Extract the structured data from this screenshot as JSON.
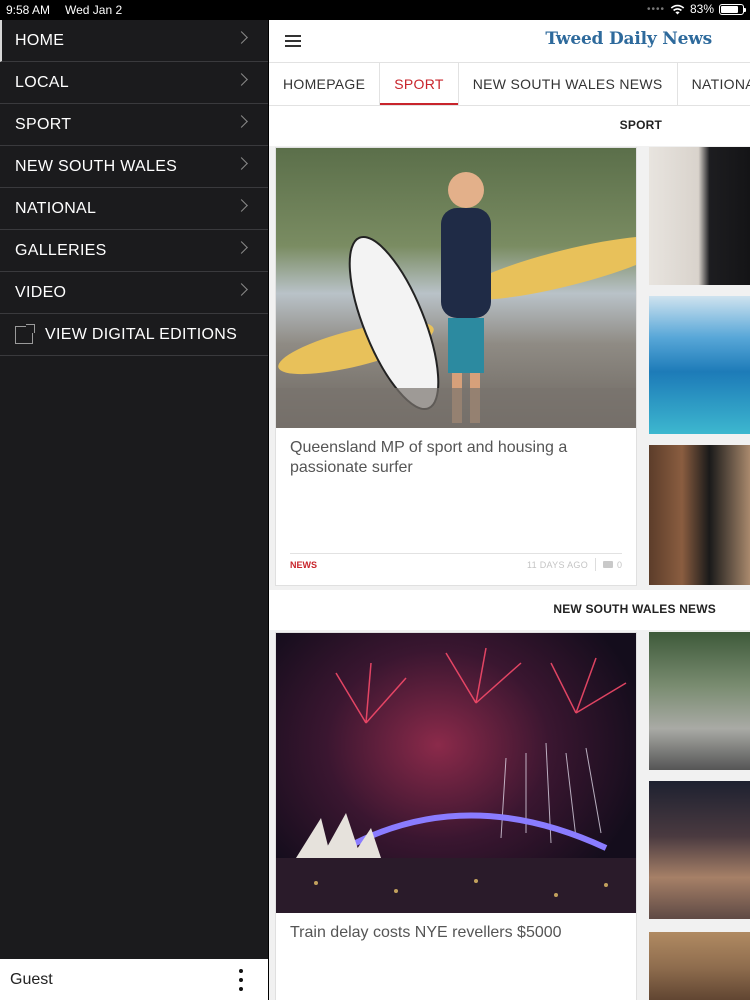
{
  "status_bar": {
    "time": "9:58 AM",
    "date": "Wed Jan 2",
    "wifi_icon": "wifi-icon",
    "battery_percent": "83%",
    "battery_level": 0.83
  },
  "sidebar": {
    "items": [
      {
        "label": "HOME"
      },
      {
        "label": "LOCAL"
      },
      {
        "label": "SPORT"
      },
      {
        "label": "NEW SOUTH WALES"
      },
      {
        "label": "NATIONAL"
      },
      {
        "label": "GALLERIES"
      },
      {
        "label": "VIDEO"
      }
    ],
    "digital_editions_label": "VIEW DIGITAL EDITIONS",
    "user_label": "Guest"
  },
  "header": {
    "brand": "Tweed Daily News",
    "brand_color": "#2e6a9c"
  },
  "tabs": [
    {
      "label": "HOMEPAGE"
    },
    {
      "label": "SPORT"
    },
    {
      "label": "NEW SOUTH WALES NEWS"
    },
    {
      "label": "NATIONAL NE"
    }
  ],
  "accent_color": "#c8242b",
  "sections": {
    "sport": {
      "title": "SPORT",
      "feature": {
        "headline": "Queensland MP of sport and housing a passionate surfer",
        "category": "NEWS",
        "age": "11 DAYS AGO",
        "comments": "0"
      }
    },
    "nsw": {
      "title": "NEW SOUTH WALES NEWS",
      "feature": {
        "headline": "Train delay costs NYE revellers $5000"
      }
    }
  }
}
